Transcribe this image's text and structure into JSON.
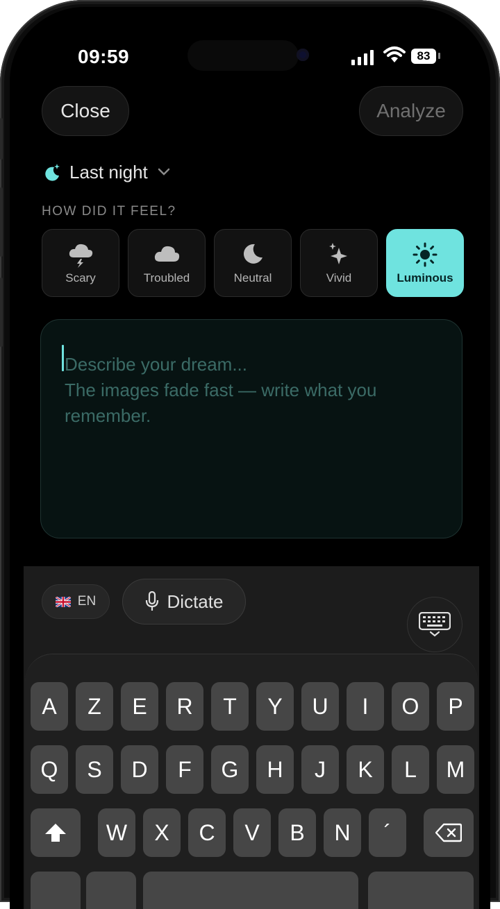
{
  "status_bar": {
    "time": "09:59",
    "battery": "83"
  },
  "header": {
    "close_label": "Close",
    "analyze_label": "Analyze"
  },
  "date_selector": {
    "label": "Last night"
  },
  "feel_section": {
    "title": "HOW DID IT FEEL?"
  },
  "moods": [
    {
      "label": "Scary",
      "icon": "storm-cloud-icon",
      "selected": false
    },
    {
      "label": "Troubled",
      "icon": "cloud-icon",
      "selected": false
    },
    {
      "label": "Neutral",
      "icon": "moon-icon",
      "selected": false
    },
    {
      "label": "Vivid",
      "icon": "sparkles-icon",
      "selected": false
    },
    {
      "label": "Luminous",
      "icon": "sun-icon",
      "selected": true
    }
  ],
  "dream_input": {
    "placeholder_line1": "Describe your dream...",
    "placeholder_line2": "The images fade fast — write what you remember."
  },
  "input_toolbar": {
    "language": "EN",
    "dictate_label": "Dictate"
  },
  "keyboard": {
    "row1": [
      "A",
      "Z",
      "E",
      "R",
      "T",
      "Y",
      "U",
      "I",
      "O",
      "P"
    ],
    "row2": [
      "Q",
      "S",
      "D",
      "F",
      "G",
      "H",
      "J",
      "K",
      "L",
      "M"
    ],
    "row3": [
      "W",
      "X",
      "C",
      "V",
      "B",
      "N",
      "´"
    ]
  },
  "colors": {
    "accent": "#6fe3df",
    "background": "#000000",
    "surface": "#121212"
  }
}
